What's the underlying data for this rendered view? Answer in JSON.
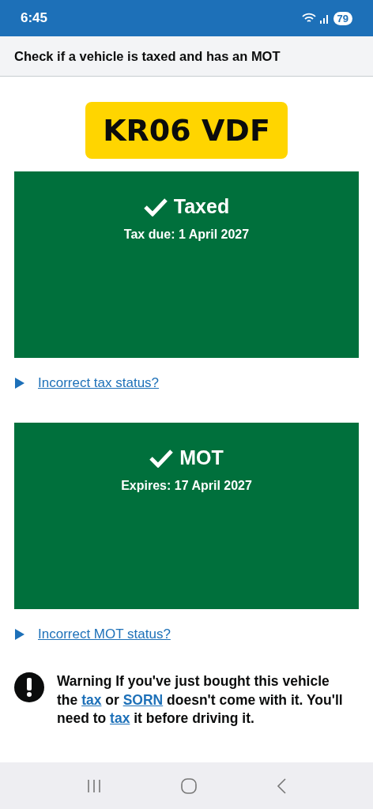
{
  "status_bar": {
    "time": "6:45",
    "battery": "79"
  },
  "header": {
    "title": "Check if a vehicle is taxed and has an MOT"
  },
  "plate": {
    "registration": "KR06 VDF"
  },
  "results": [
    {
      "title": "Taxed",
      "detail": "Tax due: 1 April 2027",
      "passed": true,
      "link": "Incorrect tax status?",
      "expanded": false
    },
    {
      "title": "MOT",
      "detail": "Expires: 17 April 2027",
      "passed": true,
      "link": "Incorrect MOT status?",
      "expanded": false
    }
  ],
  "warning": {
    "segments": [
      {
        "text": "Warning If you've just bought this vehicle the ",
        "kind": "text"
      },
      {
        "text": "tax",
        "kind": "link"
      },
      {
        "text": " or ",
        "kind": "text"
      },
      {
        "text": "SORN",
        "kind": "link"
      },
      {
        "text": " doesn't come with it. You'll need to ",
        "kind": "text"
      },
      {
        "text": "tax",
        "kind": "link"
      },
      {
        "text": " it before driving it.",
        "kind": "text"
      }
    ]
  }
}
